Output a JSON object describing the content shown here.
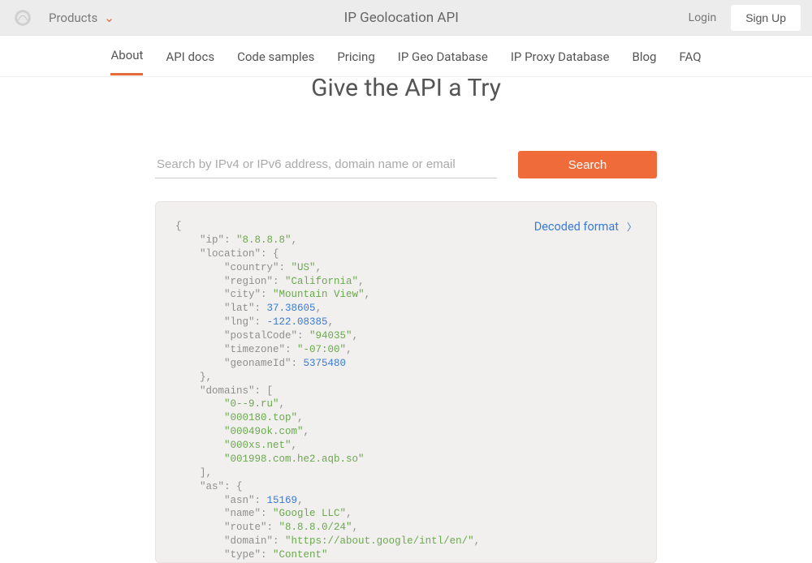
{
  "topbar": {
    "products_label": "Products",
    "title": "IP Geolocation API",
    "login_label": "Login",
    "signup_label": "Sign Up"
  },
  "nav": {
    "items": [
      "About",
      "API docs",
      "Code samples",
      "Pricing",
      "IP Geo Database",
      "IP Proxy Database",
      "Blog",
      "FAQ"
    ],
    "active_index": 0
  },
  "hero": {
    "title": "Give the API a Try",
    "search_placeholder": "Search by IPv4 or IPv6 address, domain name or email",
    "search_button": "Search"
  },
  "result": {
    "decoded_label": "Decoded format",
    "json": {
      "ip": "8.8.8.8",
      "location": {
        "country": "US",
        "region": "California",
        "city": "Mountain View",
        "lat": 37.38605,
        "lng": -122.08385,
        "postalCode": "94035",
        "timezone": "-07:00",
        "geonameId": 5375480
      },
      "domains": [
        "0--9.ru",
        "000180.top",
        "00049ok.com",
        "000xs.net",
        "001998.com.he2.aqb.so"
      ],
      "as": {
        "asn": 15169,
        "name": "Google LLC",
        "route": "8.8.8.0/24",
        "domain": "https://about.google/intl/en/",
        "type": "Content"
      }
    }
  }
}
